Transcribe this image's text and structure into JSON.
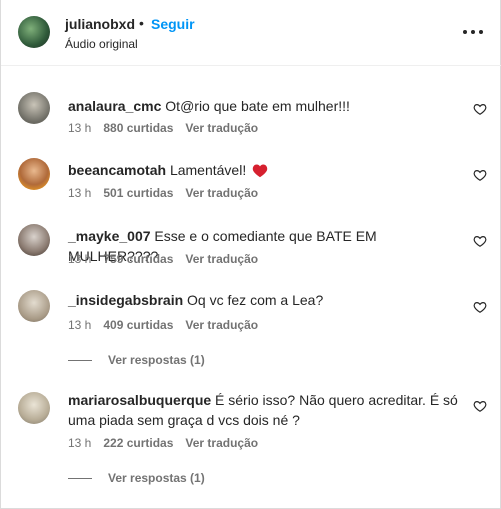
{
  "header": {
    "username": "julianobxd",
    "separator": "•",
    "follow_label": "Seguir",
    "audio_label": "Áudio original",
    "more_icon": "more-horizontal-icon"
  },
  "comments": [
    {
      "username": "analaura_cmc",
      "text": "Ot@rio que bate em mulher!!!",
      "time": "13 h",
      "likes": "880 curtidas",
      "translate": "Ver tradução"
    },
    {
      "username": "beeancamotah",
      "text": "Lamentável!",
      "emoji": "red-heart-emoji",
      "time": "13 h",
      "likes": "501 curtidas",
      "translate": "Ver tradução"
    },
    {
      "username": "_mayke_007",
      "text": "Esse e o comediante que BATE EM MULHER????",
      "time": "13 h",
      "likes": "759 curtidas",
      "translate": "Ver tradução"
    },
    {
      "username": "_insidegabsbrain",
      "text": "Oq vc fez com a Lea?",
      "time": "13 h",
      "likes": "409 curtidas",
      "translate": "Ver tradução",
      "replies": "Ver respostas (1)"
    },
    {
      "username": "mariarosalbuquerque",
      "text": "É sério isso? Não quero acreditar. É só uma piada sem graça d vcs dois né ?",
      "time": "13 h",
      "likes": "222 curtidas",
      "translate": "Ver tradução",
      "replies": "Ver respostas (1)"
    }
  ],
  "colors": {
    "link": "#0095f6",
    "secondary_text": "#737373",
    "primary_text": "#262626",
    "heart_emoji": "#d6202f"
  }
}
